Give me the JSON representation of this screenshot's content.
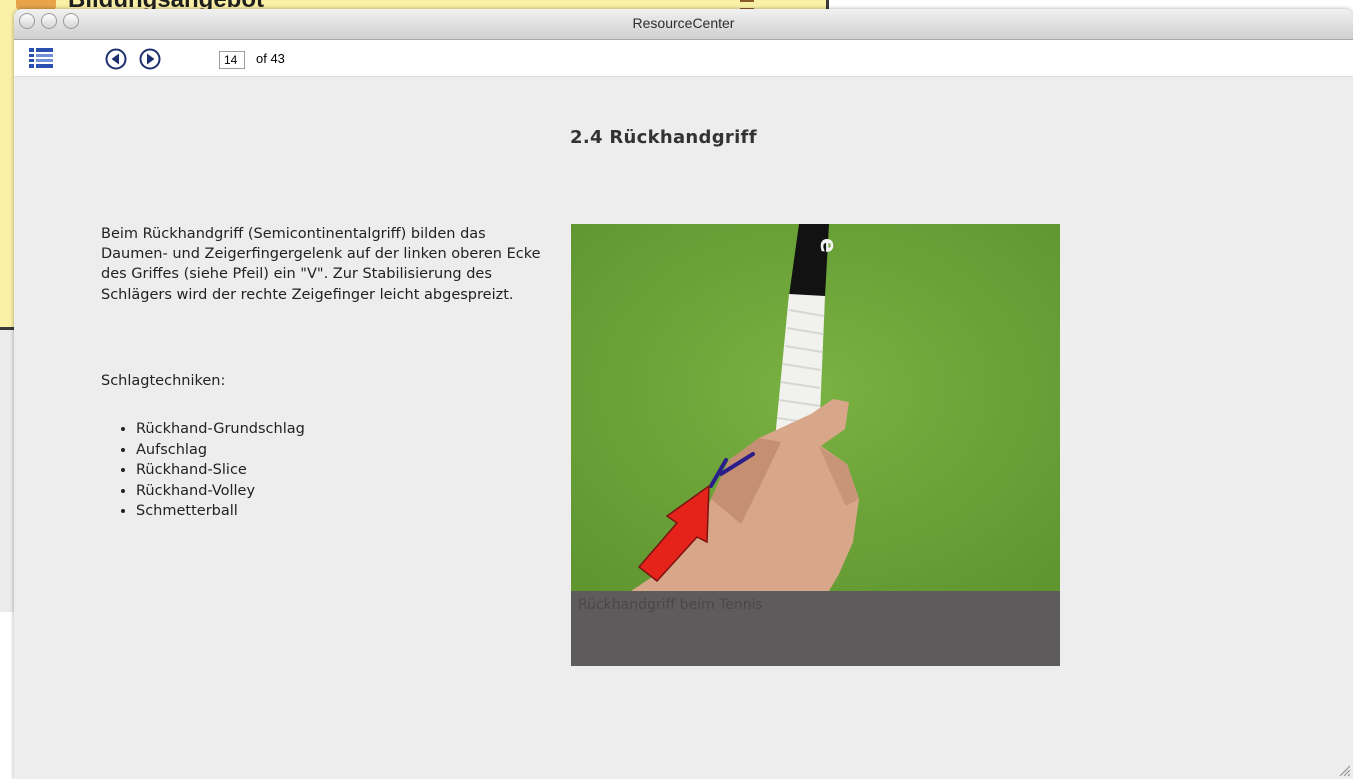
{
  "background_window": {
    "title": "Bildungsangebot"
  },
  "window": {
    "title": "ResourceCenter"
  },
  "toolbar": {
    "current_page": "14",
    "total_label": "of 43"
  },
  "content": {
    "heading": "2.4  Rückhandgriff",
    "body": "Beim Rückhandgriff (Semicontinentalgriff) bilden das Daumen- und Zeigerfingergelenk auf der linken oberen Ecke des Griffes (siehe Pfeil) ein \"V\". Zur Stabilisierung des Schlägers wird der rechte Zeigefinger leicht abgespreizt.",
    "techniques_label": "Schlagtechniken:",
    "techniques": [
      "Rückhand-Grundschlag",
      "Aufschlag",
      "Rückhand-Slice",
      "Rückhand-Volley",
      "Schmetterball"
    ],
    "figure_caption": "Rückhandgriff beim Tennis"
  },
  "colors": {
    "court_green": "#6aa238",
    "arrow_red": "#e5231b",
    "v_marker": "#2a1f8a",
    "caption_bar": "#5e5b5c"
  },
  "icons": [
    "list-view-icon",
    "previous-page-icon",
    "next-page-icon"
  ]
}
